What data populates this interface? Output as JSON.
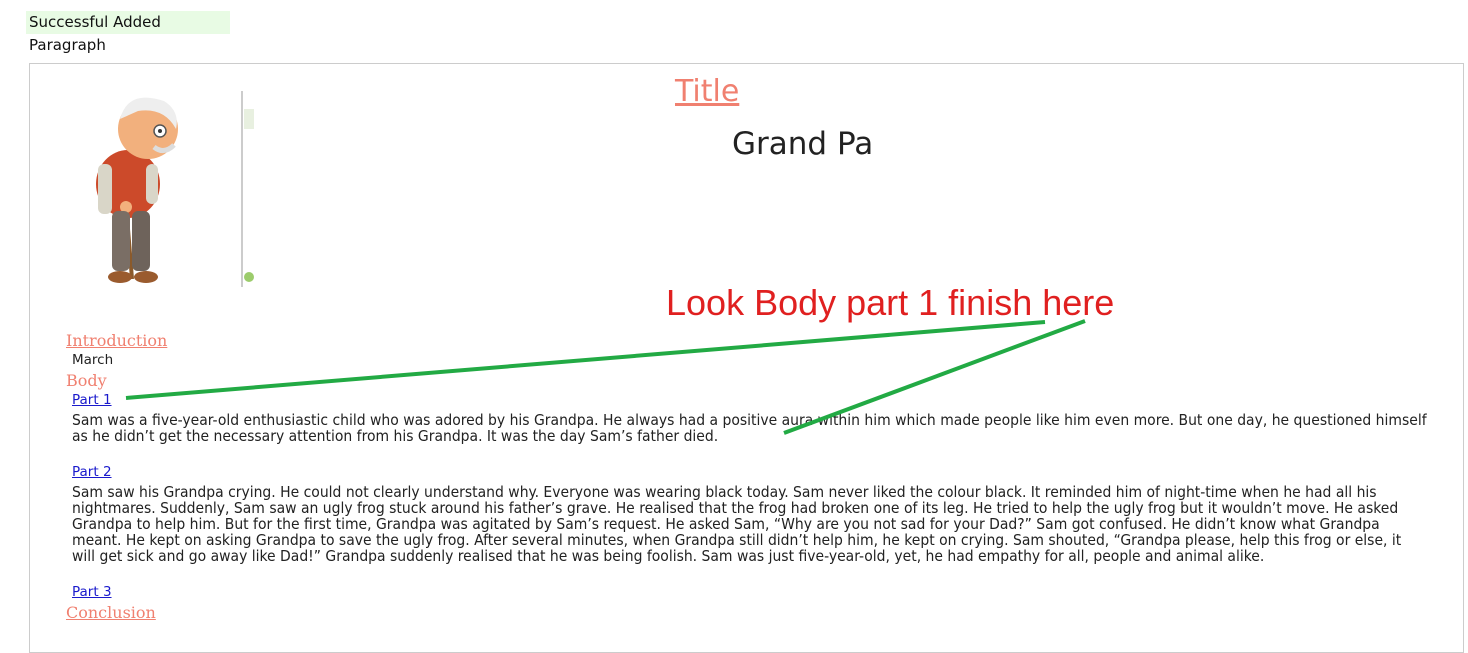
{
  "alert": {
    "text": "Successful Added Paragraph"
  },
  "document": {
    "title_link": "Title",
    "heading": "Grand Pa",
    "sections": {
      "introduction": "Introduction",
      "intro_text": "March",
      "body": "Body",
      "conclusion": "Conclusion"
    },
    "parts": [
      {
        "label": "Part 1",
        "text": "Sam was a five-year-old enthusiastic child who was adored by his Grandpa. He always had a positive aura within him which made people like him even more. But one day, he questioned himself as he didn’t get the necessary attention from his Grandpa. It was the day Sam’s father died."
      },
      {
        "label": "Part 2",
        "text": "Sam saw his Grandpa crying. He could not clearly understand why. Everyone was wearing black today. Sam never liked the colour black. It reminded him of night-time when he had all his nightmares. Suddenly, Sam saw an ugly frog stuck around his father’s grave. He realised that the frog had broken one of its leg. He tried to help the ugly frog but it wouldn’t move. He asked Grandpa to help him. But for the first time, Grandpa was agitated by Sam’s request. He asked Sam, “Why are you not sad for your Dad?” Sam got confused. He didn’t know what Grandpa meant. He kept on asking Grandpa to save the ugly frog. After several minutes, when Grandpa still didn’t help him, he kept on crying. Sam shouted, “Grandpa please, help this frog or else, it will get sick and go away like Dad!” Grandpa suddenly realised that he was being foolish. Sam was just five-year-old, yet, he had empathy for all, people and animal alike."
      },
      {
        "label": "Part 3",
        "text": ""
      }
    ]
  },
  "annotation": {
    "text": "Look Body part 1 finish here",
    "text_color": "#e02020",
    "arrow_color": "#22aa44"
  },
  "colors": {
    "section_link": "#f08070",
    "part_link": "#1a1acc",
    "alert_bg": "#e8fbe4"
  }
}
